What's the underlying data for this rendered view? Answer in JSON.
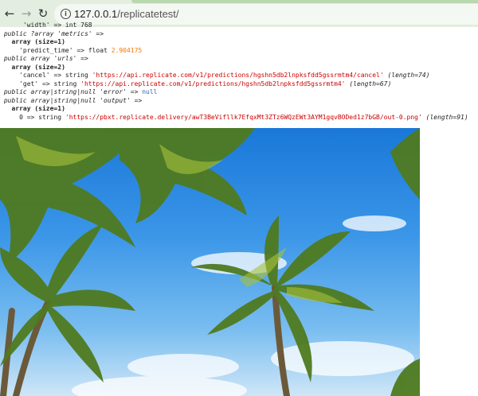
{
  "browser": {
    "url_host": "127.0.0.1",
    "url_path": "/replicatetest/",
    "back_icon": "arrow-left-icon",
    "forward_icon": "arrow-right-icon",
    "reload_icon": "reload-icon",
    "info_icon": "info-icon"
  },
  "dump": {
    "width_line": "'width' => int 768",
    "metrics_decl": "public ?array 'metrics' =>",
    "metrics_array": "array (size=1)",
    "predict_key": "'predict_time' => float ",
    "predict_val": "2.904175",
    "urls_decl": "public array 'urls' =>",
    "urls_array": "array (size=2)",
    "cancel_key": "'cancel' => string ",
    "cancel_val": "'https://api.replicate.com/v1/predictions/hgshn5db2lnpksfdd5gssrmtm4/cancel'",
    "cancel_len": "(length=74)",
    "get_key": "'get' => string ",
    "get_val": "'https://api.replicate.com/v1/predictions/hgshn5db2lnpksfdd5gssrmtm4'",
    "get_len": "(length=67)",
    "error_decl": "public array|string|null 'error' => ",
    "error_val": "null",
    "output_decl": "public array|string|null 'output' =>",
    "output_array": "array (size=1)",
    "output_key": "0 => string ",
    "output_val": "'https://pbxt.replicate.delivery/awT3BeVifllk7EfqxMt3ZTz6WQzEWt3AYM1gqvBODed1z7bGB/out-0.png'",
    "output_len": "(length=91)"
  }
}
